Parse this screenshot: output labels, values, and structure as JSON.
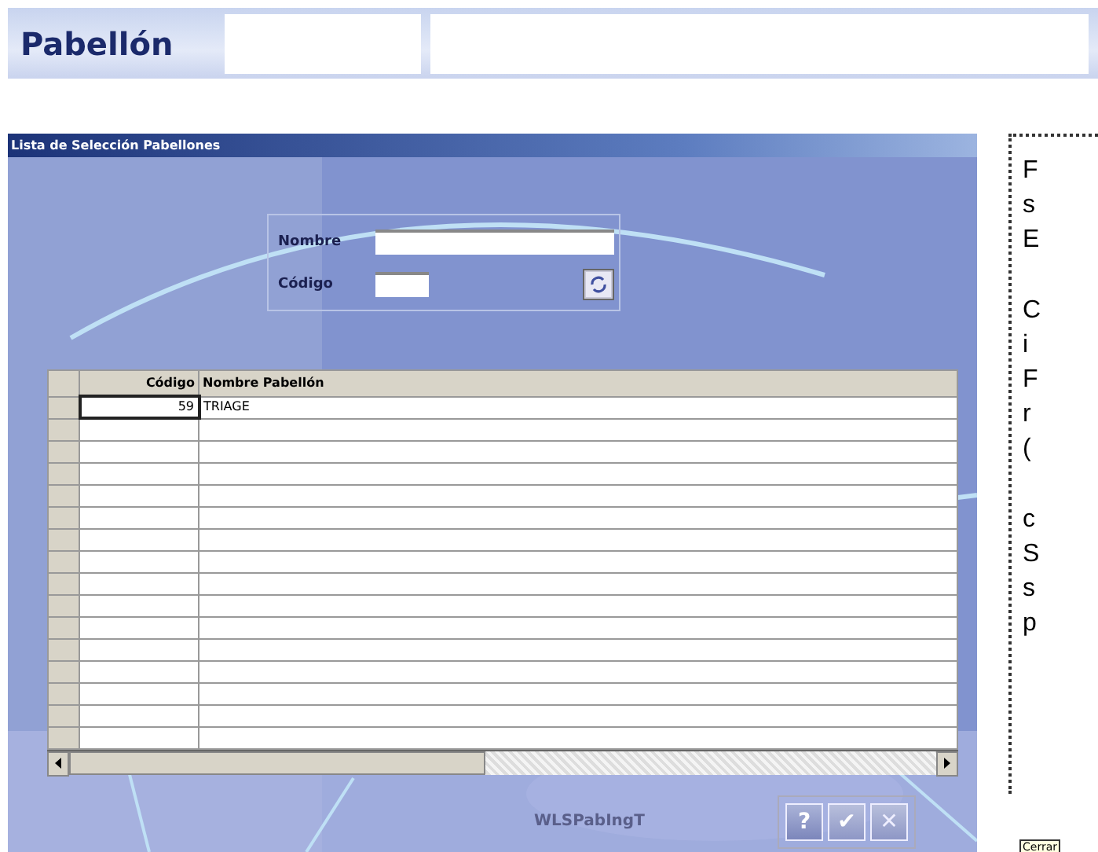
{
  "header": {
    "label": "Pabellón",
    "fields": [
      {
        "kind": "short"
      },
      {
        "kind": "long"
      }
    ]
  },
  "dialog": {
    "title": "Lista de Selección Pabellones",
    "filter": {
      "fields": [
        {
          "label": "Nombre",
          "kind": "wide"
        },
        {
          "label": "Código",
          "kind": "narrow"
        }
      ]
    },
    "table": {
      "columns": [
        "Código",
        "Nombre Pabellón"
      ],
      "rows": [
        {
          "cells": [
            "59",
            "TRIAGE"
          ],
          "selected": true
        }
      ],
      "scroll": {
        "level": 0.48
      }
    },
    "form_id": "WLSPabIngT",
    "buttons": [
      {
        "kind": "help",
        "label": "?"
      },
      {
        "kind": "accept",
        "label": "✔"
      },
      {
        "kind": "close",
        "label": "✕"
      }
    ],
    "tooltip": "Cerrar"
  },
  "note": {
    "paragraphs": [
      [
        "F",
        "s",
        "E"
      ],
      [
        "C",
        "i",
        "F",
        "r",
        "("
      ],
      [
        "c",
        "S",
        "s",
        "p"
      ]
    ]
  }
}
